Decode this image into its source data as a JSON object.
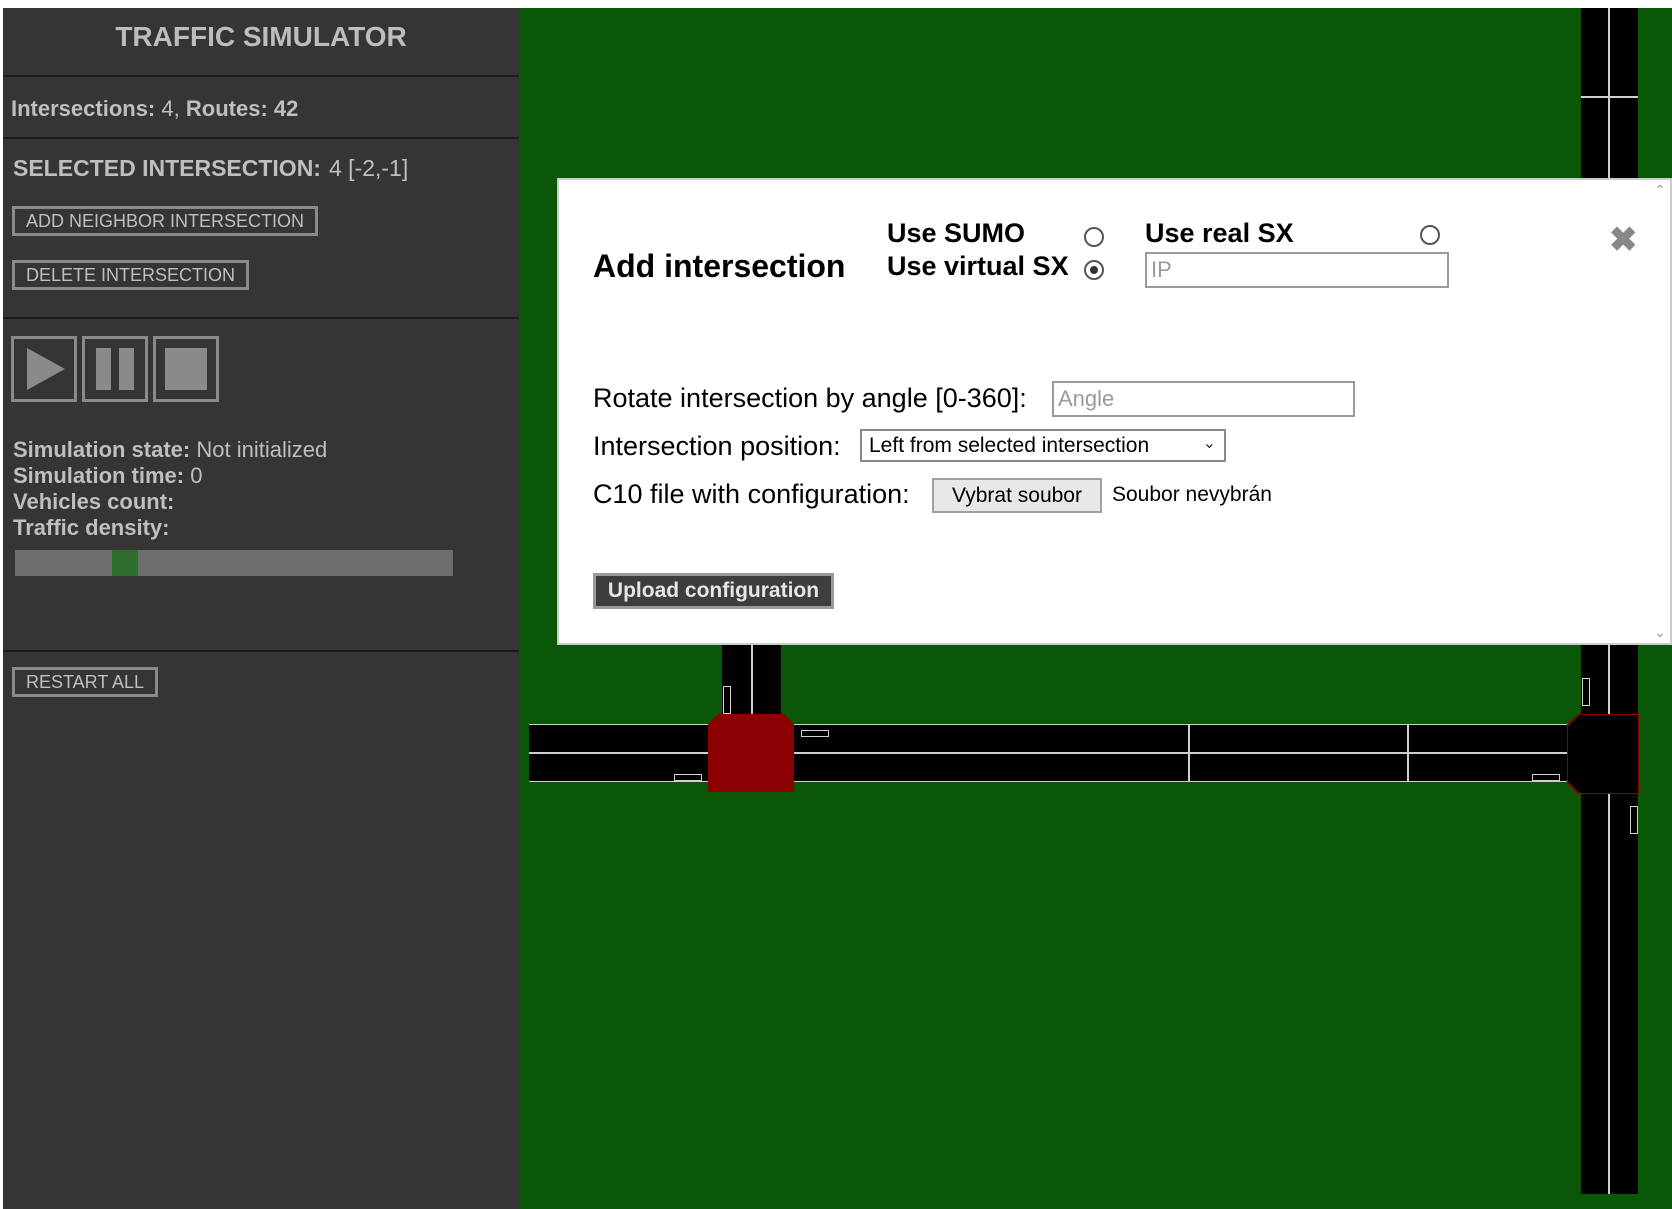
{
  "sidebar": {
    "title": "TRAFFIC SIMULATOR",
    "stats": {
      "intersections_label": "Intersections:",
      "intersections_value": "4",
      "routes_label": "Routes:",
      "routes_value": "42"
    },
    "selected": {
      "label": "SELECTED INTERSECTION:",
      "value": "4 [-2,-1]"
    },
    "buttons": {
      "add_neighbor": "ADD NEIGHBOR INTERSECTION",
      "delete": "DELETE INTERSECTION",
      "restart_all": "RESTART ALL"
    },
    "controls": {
      "play_icon": "play-icon",
      "pause_icon": "pause-icon",
      "stop_icon": "stop-icon"
    },
    "simulation": {
      "state_label": "Simulation state:",
      "state_value": "Not initialized",
      "time_label": "Simulation time:",
      "time_value": "0",
      "vehicles_label": "Vehicles count:",
      "vehicles_value": "",
      "density_label": "Traffic density:",
      "density_marker_fraction": 0.25
    }
  },
  "modal": {
    "title": "Add intersection",
    "options": {
      "use_sumo": "Use SUMO",
      "use_virtual_sx": "Use virtual SX",
      "use_real_sx": "Use real SX",
      "selected": "use_virtual_sx"
    },
    "ip_placeholder": "IP",
    "ip_value": "",
    "rotate_label": "Rotate intersection by angle [0-360]:",
    "angle_placeholder": "Angle",
    "position_label": "Intersection position:",
    "position_value": "Left from selected intersection",
    "file_label": "C10 file with configuration:",
    "file_button": "Vybrat soubor",
    "file_status": "Soubor nevybrán",
    "upload_button": "Upload configuration",
    "close_icon": "close-icon"
  },
  "colors": {
    "sidebar_bg": "#353535",
    "map_bg": "#0a5707",
    "road": "#000000",
    "selected_intersection": "#8b0000",
    "density_marker": "#2e6e2e"
  }
}
